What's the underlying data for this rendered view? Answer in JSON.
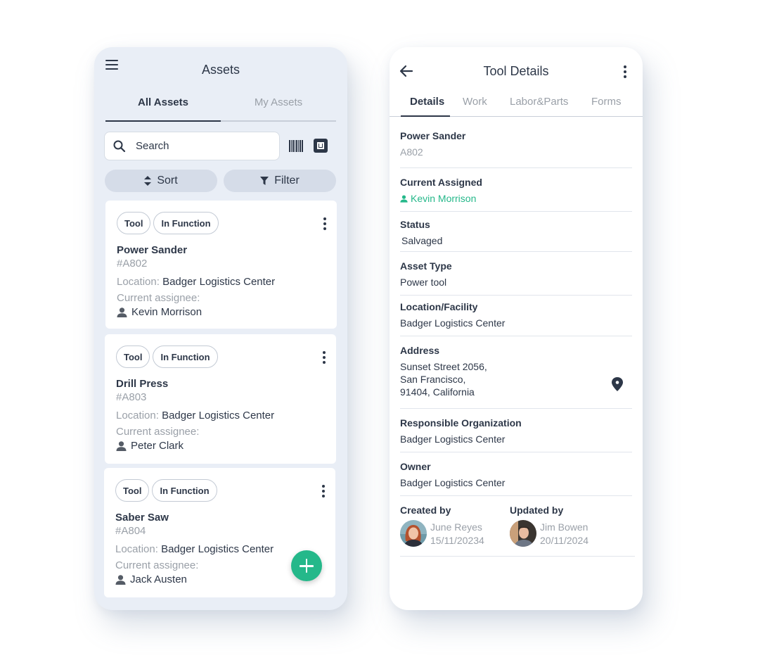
{
  "assets_screen": {
    "title": "Assets",
    "tabs": [
      {
        "label": "All Assets",
        "active": true
      },
      {
        "label": "My Assets",
        "active": false
      }
    ],
    "search": {
      "placeholder": "Search",
      "value": ""
    },
    "sort_label": "Sort",
    "filter_label": "Filter",
    "location_label": "Location:",
    "assignee_label": "Current assignee:",
    "cards": [
      {
        "chips": [
          "Tool",
          "In Function"
        ],
        "name": "Power Sander",
        "code": "#A802",
        "location": "Badger Logistics Center",
        "assignee": "Kevin Morrison"
      },
      {
        "chips": [
          "Tool",
          "In Function"
        ],
        "name": "Drill Press",
        "code": "#A803",
        "location": "Badger Logistics Center",
        "assignee": "Peter Clark"
      },
      {
        "chips": [
          "Tool",
          "In Function"
        ],
        "name": "Saber Saw",
        "code": "#A804",
        "location": "Badger Logistics Center",
        "assignee": "Jack Austen"
      }
    ],
    "icons": {
      "menu": "hamburger-menu-icon",
      "search": "search-icon",
      "barcode": "barcode-icon",
      "nfc": "nfc-scan-icon",
      "sort": "sort-arrows-icon",
      "filter": "filter-funnel-icon",
      "more": "more-vertical-icon",
      "person": "person-icon",
      "add": "plus-icon"
    }
  },
  "details_screen": {
    "title": "Tool Details",
    "tabs": [
      {
        "label": "Details",
        "active": true
      },
      {
        "label": "Work",
        "active": false
      },
      {
        "label": "Labor&Parts",
        "active": false
      },
      {
        "label": "Forms",
        "active": false
      }
    ],
    "fields": {
      "name": {
        "label": "Power Sander",
        "value": "A802"
      },
      "assigned": {
        "label": "Current Assigned",
        "value": "Kevin Morrison"
      },
      "status": {
        "label": "Status",
        "value": "Salvaged"
      },
      "asset_type": {
        "label": "Asset Type",
        "value": "Power tool"
      },
      "location": {
        "label": "Location/Facility",
        "value": "Badger Logistics Center"
      },
      "address": {
        "label": "Address",
        "lines": [
          "Sunset Street 2056,",
          "San Francisco,",
          "91404, California"
        ]
      },
      "responsible_org": {
        "label": "Responsible Organization",
        "value": "Badger Logistics Center"
      },
      "owner": {
        "label": "Owner",
        "value": "Badger Logistics Center"
      }
    },
    "created": {
      "label": "Created by",
      "name": "June Reyes",
      "date": "15/11/20234"
    },
    "updated": {
      "label": "Updated by",
      "name": "Jim Bowen",
      "date": "20/11/2024"
    },
    "colors": {
      "accent": "#25b88a",
      "text": "#2d3748",
      "muted": "#9aa0a8"
    }
  }
}
